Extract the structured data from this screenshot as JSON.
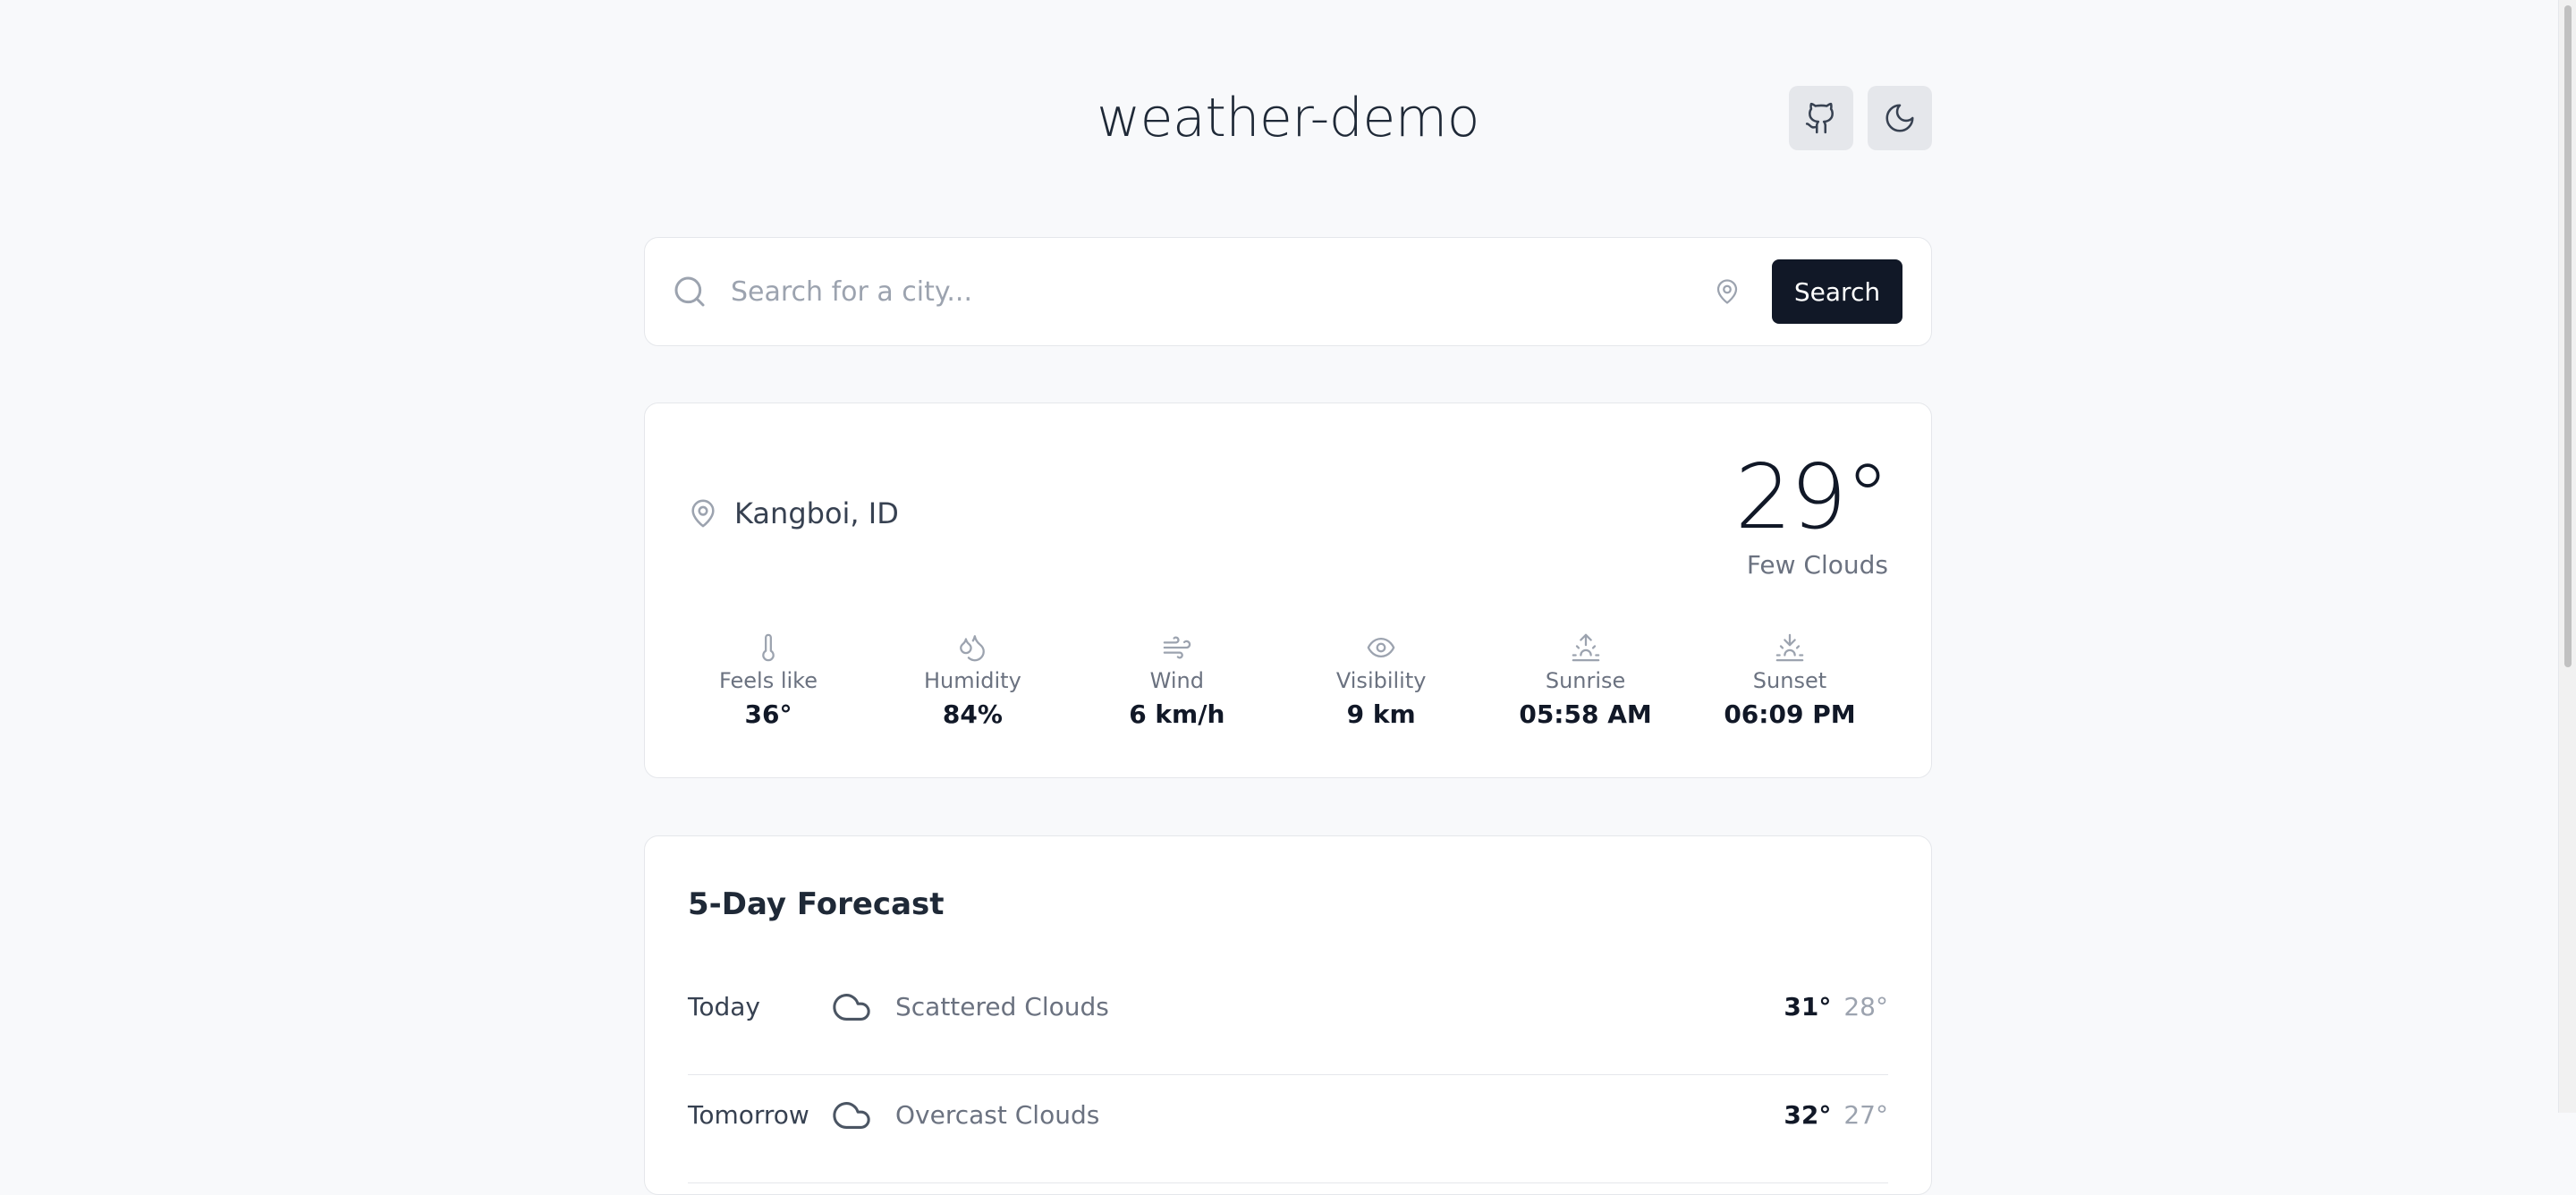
{
  "app": {
    "title": "weather-demo"
  },
  "header": {
    "github_icon": "github-icon",
    "theme_icon": "moon-icon"
  },
  "search": {
    "placeholder": "Search for a city...",
    "value": "",
    "button_label": "Search",
    "icon": "search-icon",
    "locate_icon": "map-pin-icon"
  },
  "current": {
    "location": "Kangboi, ID",
    "temperature": "29°",
    "description": "Few Clouds",
    "stats": [
      {
        "label": "Feels like",
        "value": "36°",
        "icon": "thermometer-icon"
      },
      {
        "label": "Humidity",
        "value": "84%",
        "icon": "droplets-icon"
      },
      {
        "label": "Wind",
        "value": "6 km/h",
        "icon": "wind-icon"
      },
      {
        "label": "Visibility",
        "value": "9 km",
        "icon": "eye-icon"
      },
      {
        "label": "Sunrise",
        "value": "05:58 AM",
        "icon": "sunrise-icon"
      },
      {
        "label": "Sunset",
        "value": "06:09 PM",
        "icon": "sunset-icon"
      }
    ]
  },
  "forecast": {
    "title": "5-Day Forecast",
    "days": [
      {
        "day": "Today",
        "description": "Scattered Clouds",
        "high": "31°",
        "low": "28°",
        "icon": "cloud-icon"
      },
      {
        "day": "Tomorrow",
        "description": "Overcast Clouds",
        "high": "32°",
        "low": "27°",
        "icon": "cloud-icon"
      }
    ]
  },
  "colors": {
    "background": "#f8f9fb",
    "card": "#ffffff",
    "border": "#e5e7eb",
    "primary_button": "#111827",
    "muted_text": "#6b7280"
  }
}
